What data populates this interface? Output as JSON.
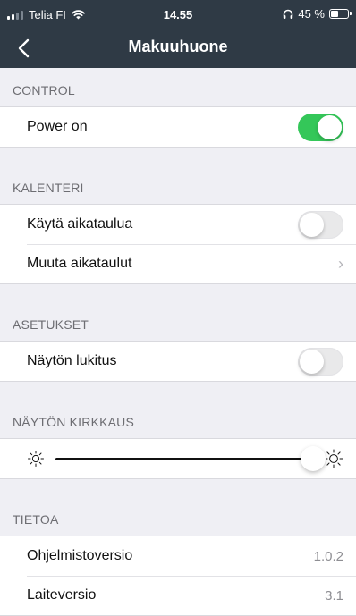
{
  "status_bar": {
    "carrier": "Telia FI",
    "time": "14.55",
    "battery_percent": "45 %",
    "battery_level": 0.45,
    "signal_bars": 4,
    "signal_active": 2
  },
  "nav": {
    "title": "Makuuhuone",
    "back_icon": "chevron-left-icon"
  },
  "sections": {
    "control": {
      "title": "CONTROL",
      "power": {
        "label": "Power on",
        "on": true
      }
    },
    "kalenteri": {
      "title": "KALENTERI",
      "use_schedule": {
        "label": "Käytä aikataulua",
        "on": false
      },
      "edit_schedules": {
        "label": "Muuta aikataulut",
        "chevron": "›"
      }
    },
    "asetukset": {
      "title": "ASETUKSET",
      "screen_lock": {
        "label": "Näytön lukitus",
        "on": false
      }
    },
    "brightness": {
      "title": "NÄYTÖN KIRKKAUS",
      "value": 1.0,
      "icon_low": "sun-small-icon",
      "icon_high": "sun-large-icon"
    },
    "tietoa": {
      "title": "TIETOA",
      "rows": [
        {
          "label": "Ohjelmistoversio",
          "value": "1.0.2"
        },
        {
          "label": "Laiteversio",
          "value": "3.1"
        }
      ]
    }
  },
  "colors": {
    "header_bg": "#2f3a45",
    "toggle_on": "#34c759",
    "page_bg": "#efeff4"
  }
}
